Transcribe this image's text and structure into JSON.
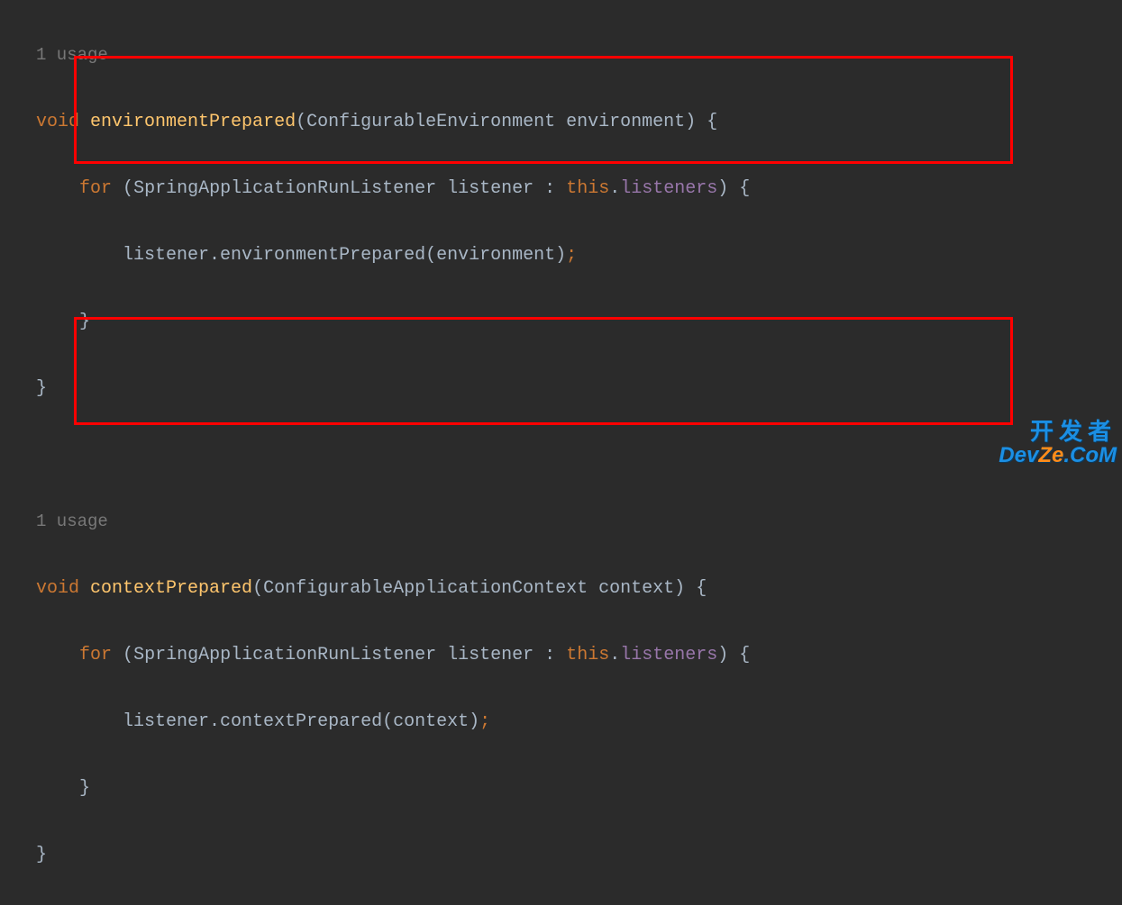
{
  "block1": {
    "usage": "1 usage",
    "kw_void": "void",
    "method_name": "environmentPrepared",
    "param_type": "ConfigurableEnvironment",
    "param_name": "environment",
    "open_brace": "{",
    "for_kw": "for",
    "loop_open": "(",
    "loop_type": "SpringApplicationRunListener",
    "loop_var": "listener",
    "colon": ":",
    "this_kw": "this",
    "dot1": ".",
    "field": "listeners",
    "loop_close": ")",
    "loop_brace": "{",
    "body_var": "listener",
    "dot2": ".",
    "body_call": "environmentPrepared",
    "body_arg": "environment",
    "semicolon": ";",
    "close_inner": "}",
    "close_outer": "}"
  },
  "block2": {
    "usage": "1 usage",
    "kw_void": "void",
    "method_name": "contextPrepared",
    "param_type": "ConfigurableApplicationContext",
    "param_name": "context",
    "open_brace": "{",
    "for_kw": "for",
    "loop_open": "(",
    "loop_type": "SpringApplicationRunListener",
    "loop_var": "listener",
    "colon": ":",
    "this_kw": "this",
    "dot1": ".",
    "field": "listeners",
    "loop_close": ")",
    "loop_brace": "{",
    "body_var": "listener",
    "dot2": ".",
    "body_call": "contextPrepared",
    "body_arg": "context",
    "semicolon": ";",
    "close_inner": "}",
    "close_outer": "}"
  },
  "watermark": {
    "line1": "开发者",
    "line2a": "Dev",
    "line2b": "Ze",
    "line2c": ".CoM"
  }
}
